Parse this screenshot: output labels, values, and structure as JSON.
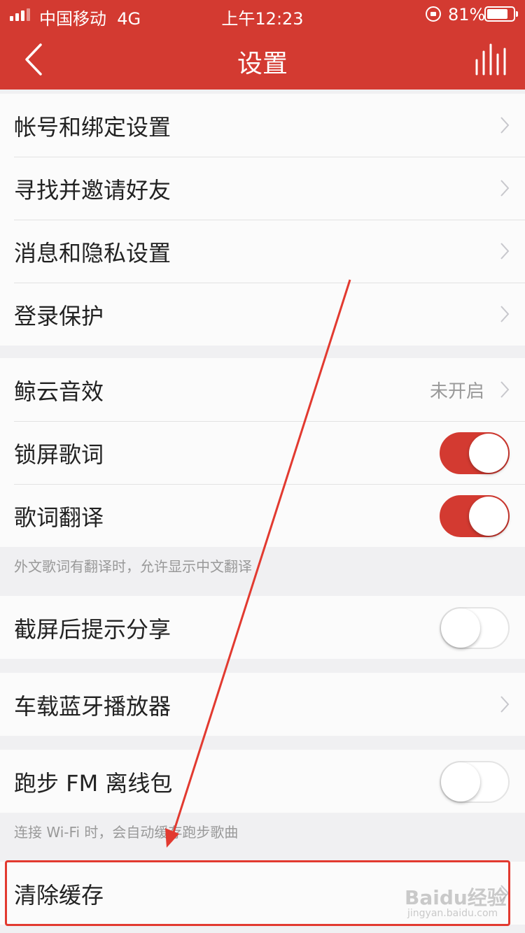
{
  "status_bar": {
    "carrier": "中国移动",
    "network": "4G",
    "time": "上午12:23",
    "battery_percent": "81%",
    "battery_level": 0.81
  },
  "nav": {
    "title": "设置",
    "back_icon": "chevron-left-icon",
    "right_icon": "equalizer-bars-icon"
  },
  "account_group": [
    {
      "label": "帐号和绑定设置"
    },
    {
      "label": "寻找并邀请好友"
    },
    {
      "label": "消息和隐私设置"
    },
    {
      "label": "登录保护"
    }
  ],
  "audio_group": {
    "sound_effect": {
      "label": "鲸云音效",
      "value": "未开启"
    },
    "lock_lyrics": {
      "label": "锁屏歌词",
      "enabled": true
    },
    "lyric_translate": {
      "label": "歌词翻译",
      "enabled": true
    },
    "lyric_translate_note": "外文歌词有翻译时，允许显示中文翻译"
  },
  "screenshot_share": {
    "label": "截屏后提示分享",
    "enabled": false
  },
  "car_bluetooth": {
    "label": "车载蓝牙播放器"
  },
  "running_fm": {
    "label": "跑步 FM 离线包",
    "enabled": false,
    "note": "连接 Wi-Fi 时，会自动缓存跑步歌曲"
  },
  "clear_cache": {
    "label": "清除缓存"
  },
  "annotation": {
    "color": "#e23a30"
  },
  "watermark": {
    "logo": "Baidu经验",
    "url": "jingyan.baidu.com"
  },
  "colors": {
    "accent": "#d33a31",
    "background": "#f0f0f2",
    "row": "#fbfbfb"
  }
}
